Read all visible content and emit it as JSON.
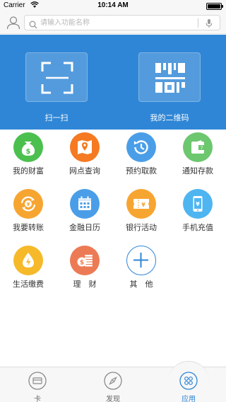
{
  "status_bar": {
    "carrier": "Carrier",
    "time": "10:14 AM"
  },
  "header": {
    "search_placeholder": "请输入功能名称"
  },
  "banner": {
    "scan_label": "扫一扫",
    "qr_label": "我的二维码"
  },
  "grid": {
    "items": [
      {
        "label": "我的财富",
        "icon": "money-bag-icon",
        "color": "#4cc04f"
      },
      {
        "label": "网点查询",
        "icon": "map-pin-icon",
        "color": "#f57a22"
      },
      {
        "label": "预约取款",
        "icon": "clock-icon",
        "color": "#4a9ee8"
      },
      {
        "label": "通知存款",
        "icon": "wallet-icon",
        "color": "#6cc76e"
      },
      {
        "label": "我要转账",
        "icon": "transfer-icon",
        "color": "#f7a531"
      },
      {
        "label": "金融日历",
        "icon": "calendar-icon",
        "color": "#4a9ee8"
      },
      {
        "label": "银行活动",
        "icon": "ticket-icon",
        "color": "#f7a531"
      },
      {
        "label": "手机充值",
        "icon": "phone-icon",
        "color": "#4fb5f0"
      },
      {
        "label": "生活缴费",
        "icon": "water-drop-icon",
        "color": "#f6b92a"
      },
      {
        "label": "理　财",
        "icon": "coins-icon",
        "color": "#ec7b55"
      },
      {
        "label": "其　他",
        "icon": "plus-icon",
        "color": "#2f86d6"
      }
    ]
  },
  "tab_bar": {
    "tabs": [
      {
        "label": "卡",
        "icon": "card-icon"
      },
      {
        "label": "发现",
        "icon": "compass-icon"
      },
      {
        "label": "应用",
        "icon": "apps-icon"
      }
    ]
  }
}
